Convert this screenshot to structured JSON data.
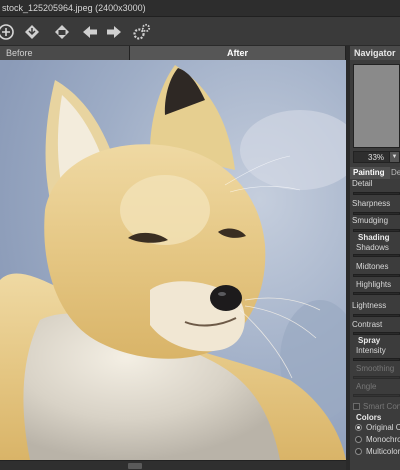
{
  "window": {
    "title": "stock_125205964.jpeg (2400x3000)"
  },
  "toolbar": {
    "buttons": [
      {
        "name": "open-icon"
      },
      {
        "name": "save-icon"
      },
      {
        "name": "print-icon"
      },
      {
        "name": "export-icon"
      },
      {
        "name": "undo-icon"
      },
      {
        "name": "redo-icon"
      },
      {
        "name": "settings-icon"
      }
    ]
  },
  "tabs": {
    "before": "Before",
    "after": "After"
  },
  "navigator": {
    "title": "Navigator",
    "zoom": "33%"
  },
  "panel": {
    "tabs": {
      "painting": "Painting",
      "decoration": "Decoration"
    },
    "params": {
      "detail": "Detail",
      "sharpness": "Sharpness",
      "smudging": "Smudging",
      "shading": "Shading",
      "shadows": "Shadows",
      "midtones": "Midtones",
      "highlights": "Highlights",
      "lightness": "Lightness",
      "contrast": "Contrast",
      "spray": "Spray",
      "intensity": "Intensity",
      "smoothing": "Smoothing",
      "angle": "Angle",
      "smart_contrast": "Smart Contrast"
    },
    "colors": {
      "title": "Colors",
      "options": [
        "Original Colors",
        "Monochrome",
        "Multicolor"
      ],
      "selected": "Original Colors"
    }
  },
  "theme": {
    "panel_bg": "#3c3c3c",
    "header_bg": "#4a4a4a",
    "sky": "#a7b3c8",
    "fur": "#e7cf95"
  }
}
